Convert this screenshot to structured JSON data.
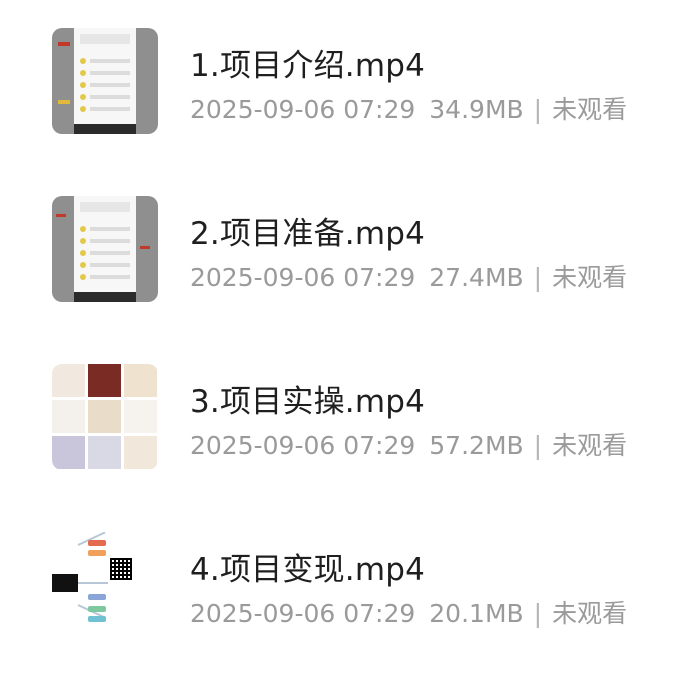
{
  "items": [
    {
      "title": "1.项目介绍.mp4",
      "date": "2025-09-06 07:29",
      "size": "34.9MB",
      "status": "未观看",
      "thumbnail": "phone-screenshot-thumbnail"
    },
    {
      "title": "2.项目准备.mp4",
      "date": "2025-09-06 07:29",
      "size": "27.4MB",
      "status": "未观看",
      "thumbnail": "phone-screenshot-thumbnail"
    },
    {
      "title": "3.项目实操.mp4",
      "date": "2025-09-06 07:29",
      "size": "57.2MB",
      "status": "未观看",
      "thumbnail": "image-grid-thumbnail"
    },
    {
      "title": "4.项目变现.mp4",
      "date": "2025-09-06 07:29",
      "size": "20.1MB",
      "status": "未观看",
      "thumbnail": "mind-map-thumbnail"
    }
  ],
  "separator": "|"
}
